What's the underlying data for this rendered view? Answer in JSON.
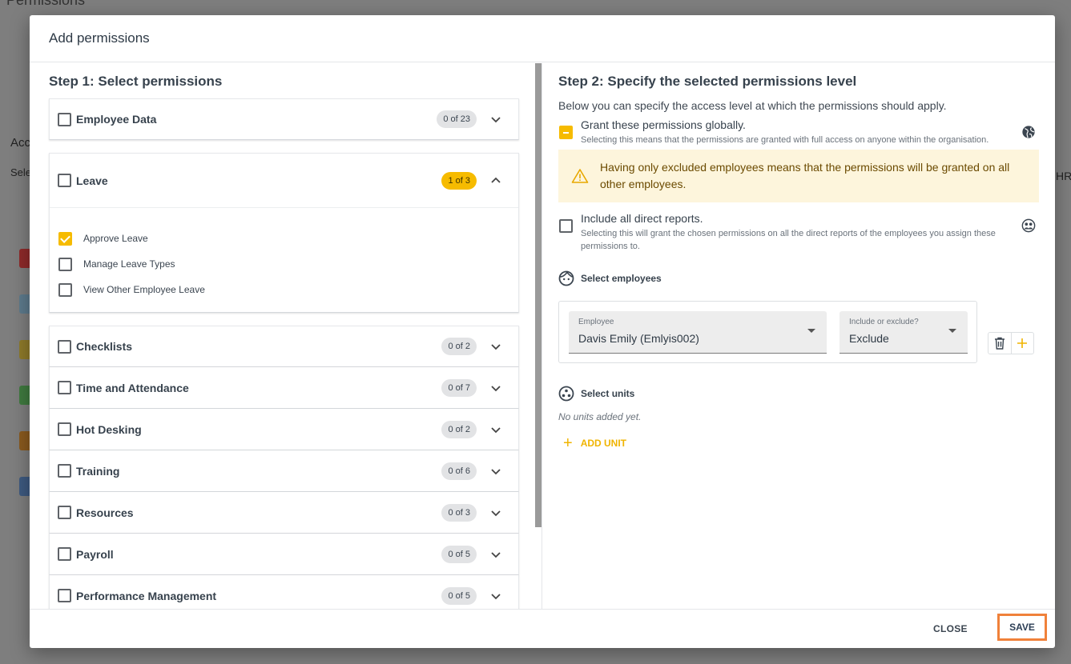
{
  "background": {
    "title": "Permissions",
    "right_fragment": "HR",
    "left_fragments": [
      "Acc",
      "Sele"
    ]
  },
  "modal": {
    "title": "Add permissions",
    "step1": {
      "title": "Step 1: Select permissions",
      "categories": [
        {
          "label": "Employee Data",
          "badge": "0 of 23"
        },
        {
          "label": "Leave",
          "badge": "1 of 3",
          "expanded": true,
          "items": [
            {
              "label": "Approve Leave",
              "checked": true
            },
            {
              "label": "Manage Leave Types",
              "checked": false
            },
            {
              "label": "View Other Employee Leave",
              "checked": false
            }
          ]
        },
        {
          "label": "Checklists",
          "badge": "0 of 2"
        },
        {
          "label": "Time and Attendance",
          "badge": "0 of 7"
        },
        {
          "label": "Hot Desking",
          "badge": "0 of 2"
        },
        {
          "label": "Training",
          "badge": "0 of 6"
        },
        {
          "label": "Resources",
          "badge": "0 of 3"
        },
        {
          "label": "Payroll",
          "badge": "0 of 5"
        },
        {
          "label": "Performance Management",
          "badge": "0 of 5"
        }
      ]
    },
    "step2": {
      "title": "Step 2: Specify the selected permissions level",
      "description": "Below you can specify the access level at which the permissions should apply.",
      "global": {
        "title": "Grant these permissions globally.",
        "subtitle": "Selecting this means that the permissions are granted with full access on anyone within the organisation."
      },
      "warning": "Having only excluded employees means that the permissions will be granted on all other employees.",
      "direct_reports": {
        "title": "Include all direct reports.",
        "subtitle": "Selecting this will grant the chosen permissions on all the direct reports of the employees you assign these permissions to."
      },
      "select_employees": {
        "title": "Select employees",
        "employee_label": "Employee",
        "employee_value": "Davis Emily (Emlyis002)",
        "mode_label": "Include or exclude?",
        "mode_value": "Exclude"
      },
      "select_units": {
        "title": "Select units",
        "empty_text": "No units added yet.",
        "add_label": "ADD UNIT"
      }
    },
    "footer": {
      "close_label": "CLOSE",
      "save_label": "SAVE"
    }
  },
  "colors": {
    "accent": "#f6bb00",
    "save_highlight": "#f0813a",
    "warning_bg": "#fdf5dc"
  }
}
